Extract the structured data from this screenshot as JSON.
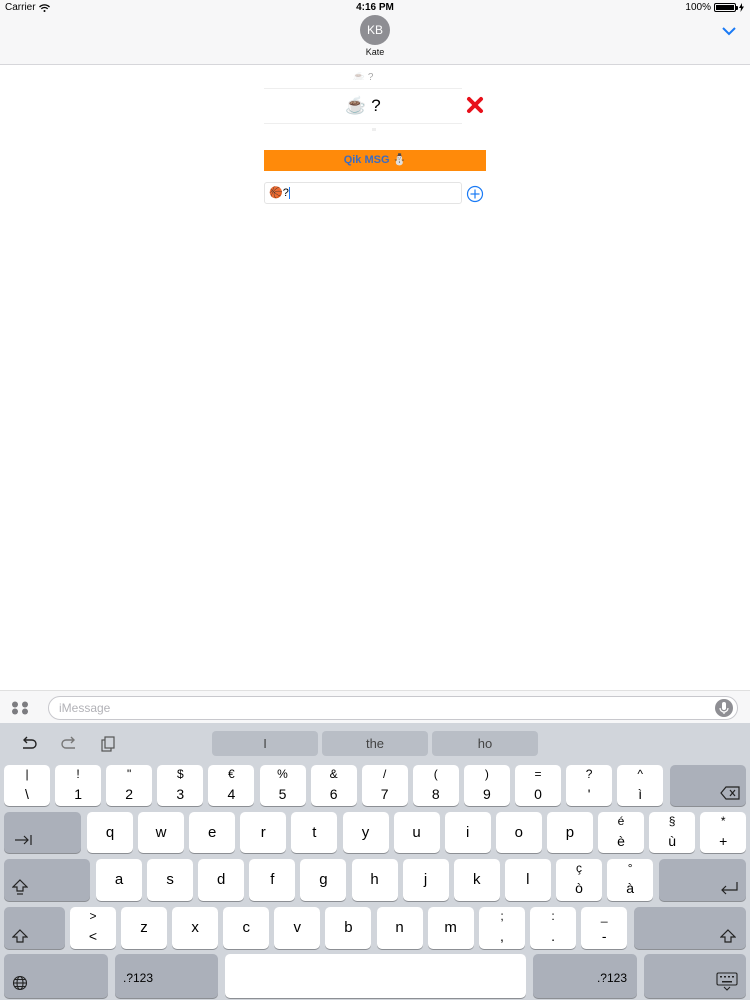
{
  "status_bar": {
    "carrier": "Carrier",
    "time": "4:16 PM",
    "battery_text": "100%",
    "battery_level": 1.0
  },
  "header": {
    "avatar_initials": "KB",
    "contact_name": "Kate"
  },
  "extension": {
    "message_text": "☕️ ?",
    "button_label": "Qik MSG ⛄️",
    "input_value": "🏀?",
    "colors": {
      "button_bg": "#ff8a0a",
      "button_text": "#3b6cc3",
      "delete": "#e8101a",
      "add": "#1a7af5"
    }
  },
  "imessage": {
    "placeholder": "iMessage"
  },
  "keyboard": {
    "suggestions": [
      "I",
      "the",
      "ho"
    ],
    "row1": [
      {
        "top": "|",
        "bottom": "\\"
      },
      {
        "top": "!",
        "bottom": "1"
      },
      {
        "top": "\"",
        "bottom": "2"
      },
      {
        "top": "$",
        "bottom": "3"
      },
      {
        "top": "€",
        "bottom": "4"
      },
      {
        "top": "%",
        "bottom": "5"
      },
      {
        "top": "&",
        "bottom": "6"
      },
      {
        "top": "/",
        "bottom": "7"
      },
      {
        "top": "(",
        "bottom": "8"
      },
      {
        "top": ")",
        "bottom": "9"
      },
      {
        "top": "=",
        "bottom": "0"
      },
      {
        "top": "?",
        "bottom": "'"
      },
      {
        "top": "^",
        "bottom": "ì"
      }
    ],
    "row2_letters": [
      "q",
      "w",
      "e",
      "r",
      "t",
      "y",
      "u",
      "i",
      "o",
      "p"
    ],
    "row2_extra": [
      {
        "top": "é",
        "bottom": "è"
      },
      {
        "top": "§",
        "bottom": "ù"
      },
      {
        "top": "*",
        "bottom": "+"
      }
    ],
    "row3_letters": [
      "a",
      "s",
      "d",
      "f",
      "g",
      "h",
      "j",
      "k",
      "l"
    ],
    "row3_extra": [
      {
        "top": "ç",
        "bottom": "ò"
      },
      {
        "top": "°",
        "bottom": "à"
      }
    ],
    "row4_first": {
      "top": ">",
      "bottom": "<"
    },
    "row4_letters": [
      "z",
      "x",
      "c",
      "v",
      "b",
      "n",
      "m"
    ],
    "row4_extra": [
      {
        "top": ";",
        "bottom": ","
      },
      {
        "top": ":",
        "bottom": "."
      },
      {
        "top": "_",
        "bottom": "-"
      }
    ],
    "numbers_label": ".?123"
  }
}
